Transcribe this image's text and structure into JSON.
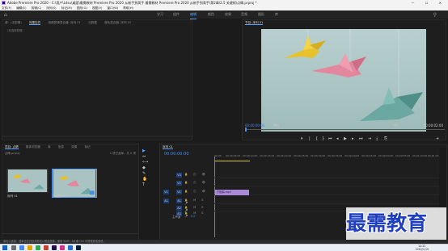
{
  "titlebar": {
    "text": "Adobe Premiere Pro 2020 - C:\\用户\\Ldsu\\桌面\\最需教材 Premiere Pro 2020 从新手到高手 最需教材 Premiere Pro 2020 从新手到高手\\第2章\\2.5 关键帧\\点睛.prproj *",
    "controls": "— ☐ ✕"
  },
  "menubar": [
    "文件(F)",
    "编辑(E)",
    "剪辑(C)",
    "序列(S)",
    "标记(M)",
    "图形(G)",
    "视图(V)",
    "窗口(W)",
    "帮助(H)"
  ],
  "workspaces": [
    "学习",
    "组件",
    "编辑",
    "颜色",
    "效果",
    "音频",
    "图形",
    "库"
  ],
  "source_panel": {
    "tabs": [
      "源：(无剪辑)",
      "效果控件",
      "音频剪辑混合器: 序列 01",
      "元数据",
      "音轨混合器: 序列 01"
    ],
    "subtext": "（未选择剪辑）"
  },
  "program_panel": {
    "tab": "节目: 序列 01",
    "timecode_in": "00:00:00:00",
    "fit": "适合",
    "ratio": "1/2",
    "timecode_out": "00:00:02:00"
  },
  "transport": [
    "⏵",
    "|",
    "{",
    "}",
    "⏮",
    "◂",
    "▶",
    "▸",
    "⏭",
    "⇥",
    "⤓",
    "⎘",
    "+"
  ],
  "project_panel": {
    "tabs": [
      "项目: 点睛",
      "媒体浏览器",
      "库",
      "信息",
      "效果",
      "标记"
    ],
    "file_name": "点睛.prproj",
    "item_count": "1 项已选择，共 2 项",
    "items": [
      {
        "label": "序列 01"
      },
      {
        "label": "千纸鹤.mp4"
      }
    ]
  },
  "tools": [
    "▶",
    "⇔",
    "⟷",
    "◆",
    "✎",
    "✋",
    "T"
  ],
  "timeline": {
    "tab": "序列 01",
    "timecode": "00:00:00:00",
    "ruler": [
      "00:00",
      "00:00:05:00",
      "00:00:10:00",
      "00:00:15:00",
      "00:00:20:00",
      "00:00:25:00",
      "00:00:30:00",
      "00:00:35:00",
      "00:00:40:00",
      "00:00:45:00",
      "00:00:50:00",
      "00:00:55:00",
      "00:01:00:00",
      "00:01:05:00"
    ],
    "tracks": [
      {
        "sel": "",
        "name": "V3",
        "icons": "🔒 ◫ 👁"
      },
      {
        "sel": "",
        "name": "V2",
        "icons": "🔒 ◫ 👁"
      },
      {
        "sel": "V1",
        "name": "V1",
        "icons": "🔒 ◫ 👁"
      },
      {
        "sel": "A1",
        "name": "A1",
        "icons": "🔒 M S 🎤"
      },
      {
        "sel": "",
        "name": "A2",
        "icons": "🔒 M S 🎤"
      },
      {
        "sel": "",
        "name": "A3",
        "icons": "🔒 M S 🎤"
      }
    ],
    "mix_label": "主声道",
    "mix_value": "0.0",
    "clip_label": "千纸鹤.mp4"
  },
  "status": "单击以选择，或单击空白处并拖动以框选选择。使用 Shift、Alt 和 Ctrl 可获得其他选项。",
  "taskbar": {
    "time": "14:22",
    "date": "2022/1/19"
  },
  "watermark": "最需教育",
  "colors": {
    "accent": "#3f8df0",
    "clip": "#a88ad8",
    "workarea": "#d7c54a",
    "watermark": "#1f3fbf"
  }
}
